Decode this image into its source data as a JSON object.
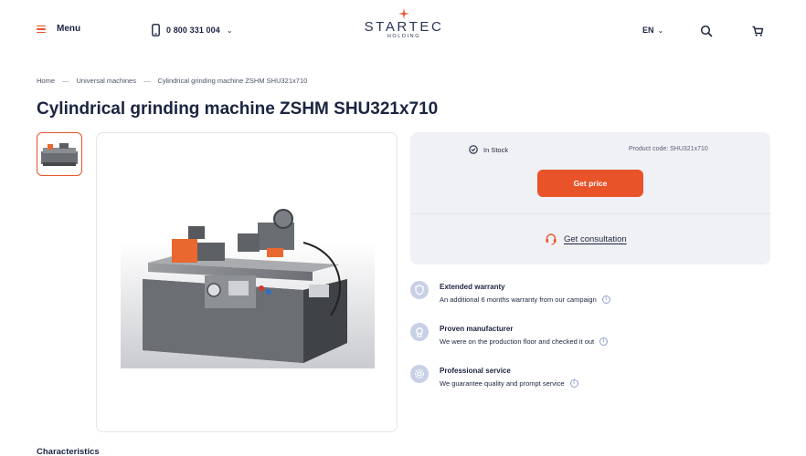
{
  "header": {
    "menu_label": "Menu",
    "phone": "0 800 331 004",
    "logo_text": "STARTEC",
    "logo_sub": "HOLDING",
    "language": "EN",
    "accent": "#e8532a"
  },
  "breadcrumb": [
    "Home",
    "Universal machines",
    "Cylindrical grinding machine ZSHM SHU321x710"
  ],
  "title": "Cylindrical grinding machine ZSHM SHU321x710",
  "panel": {
    "stock": "In Stock",
    "product_code": "Product code: SHU321x710",
    "get_price": "Get price",
    "consultation": "Get consultation"
  },
  "features": [
    {
      "title": "Extended warranty",
      "desc": "An additional 6 months warranty from our campaign",
      "icon": "shield-icon"
    },
    {
      "title": "Proven manufacturer",
      "desc": "We were on the production floor and checked it out",
      "icon": "factory-icon"
    },
    {
      "title": "Professional service",
      "desc": "We guarantee quality and prompt service",
      "icon": "service-gear-icon"
    }
  ],
  "characteristics_title": "Characteristics"
}
